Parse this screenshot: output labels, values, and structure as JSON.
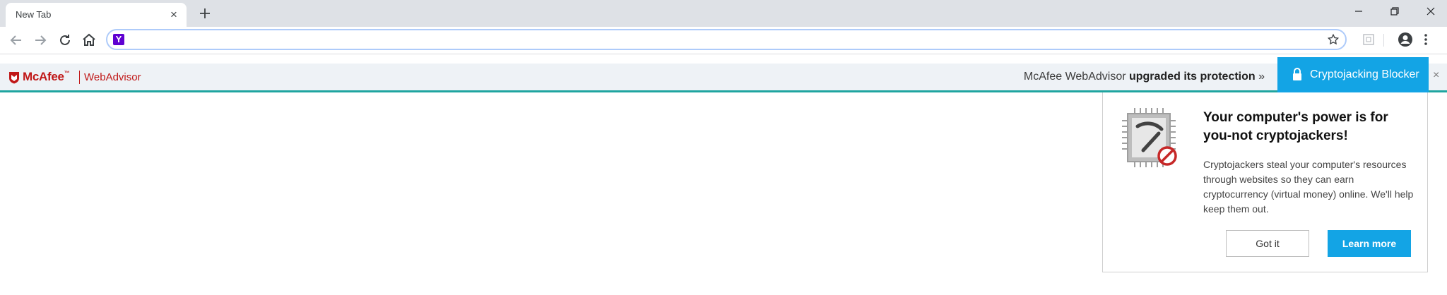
{
  "browser": {
    "tab_title": "New Tab",
    "tab_close": "×",
    "address_favicon": "Y",
    "omnibox_value": "",
    "icons": [
      "back-icon",
      "forward-icon",
      "reload-icon",
      "home-icon",
      "star-icon",
      "extension-icon",
      "profile-icon",
      "menu-icon",
      "minimize-icon",
      "restore-icon",
      "close-icon",
      "plus-icon"
    ]
  },
  "mcafee_bar": {
    "brand": "McAfee",
    "brand_tm": "™",
    "product": "WebAdvisor",
    "upgrade_prefix": "McAfee WebAdvisor ",
    "upgrade_bold": "upgraded its protection",
    "upgrade_suffix": " »",
    "feature_tab": "Cryptojacking Blocker",
    "close": "×",
    "accent_color": "#13a4e5",
    "brand_color": "#c01818"
  },
  "popup": {
    "title": "Your computer's power is for you-not cryptojackers!",
    "body": "Cryptojackers steal your computer's resources through websites so they can earn cryptocurrency (virtual money) online. We'll help keep them out.",
    "got_it": "Got it",
    "learn_more": "Learn more"
  }
}
